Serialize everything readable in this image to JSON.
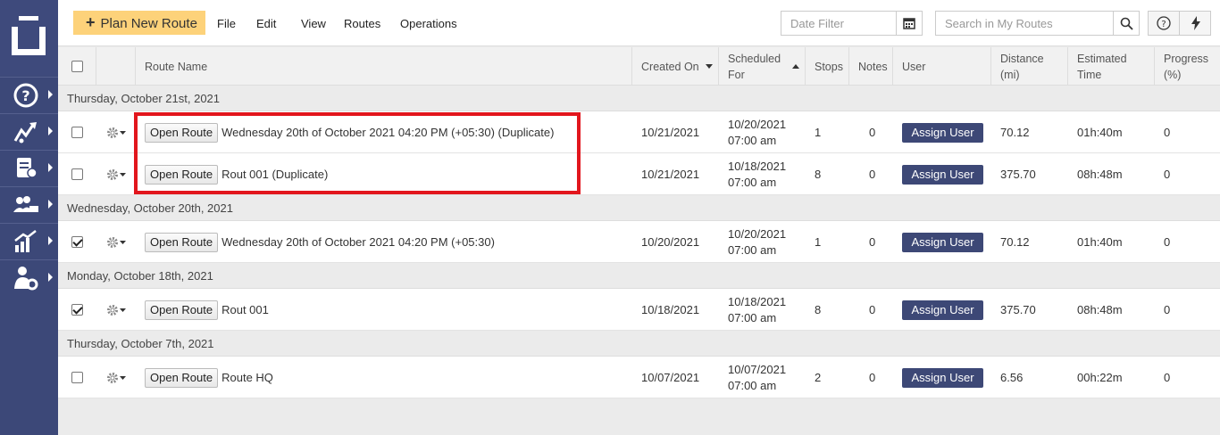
{
  "toolbar": {
    "plan_button": "Plan New Route",
    "menu": [
      "File",
      "Edit",
      "View",
      "Routes",
      "Operations"
    ],
    "date_filter_placeholder": "Date Filter",
    "search_placeholder": "Search in My Routes"
  },
  "columns": {
    "route_name": "Route Name",
    "created_on": "Created On",
    "scheduled_for": [
      "Scheduled",
      "For"
    ],
    "stops": "Stops",
    "notes": "Notes",
    "user": "User",
    "distance": [
      "Distance",
      "(mi)"
    ],
    "estimated_time": [
      "Estimated",
      "Time"
    ],
    "progress": [
      "Progress",
      "(%)"
    ]
  },
  "groups": [
    {
      "label": "Thursday, October 21st, 2021",
      "rows": [
        {
          "checked": false,
          "open_label": "Open Route",
          "name": "Wednesday 20th of October 2021 04:20 PM (+05:30) (Duplicate)",
          "created": "10/21/2021",
          "sched_date": "10/20/2021",
          "sched_time": "07:00 am",
          "stops": "1",
          "notes": "0",
          "assign": "Assign User",
          "distance": "70.12",
          "time": "01h:40m",
          "progress": "0"
        },
        {
          "checked": false,
          "open_label": "Open Route",
          "name": "Rout 001 (Duplicate)",
          "created": "10/21/2021",
          "sched_date": "10/18/2021",
          "sched_time": "07:00 am",
          "stops": "8",
          "notes": "0",
          "assign": "Assign User",
          "distance": "375.70",
          "time": "08h:48m",
          "progress": "0"
        }
      ]
    },
    {
      "label": "Wednesday, October 20th, 2021",
      "rows": [
        {
          "checked": true,
          "open_label": "Open Route",
          "name": "Wednesday 20th of October 2021 04:20 PM (+05:30)",
          "created": "10/20/2021",
          "sched_date": "10/20/2021",
          "sched_time": "07:00 am",
          "stops": "1",
          "notes": "0",
          "assign": "Assign User",
          "distance": "70.12",
          "time": "01h:40m",
          "progress": "0"
        }
      ]
    },
    {
      "label": "Monday, October 18th, 2021",
      "rows": [
        {
          "checked": true,
          "open_label": "Open Route",
          "name": "Rout 001",
          "created": "10/18/2021",
          "sched_date": "10/18/2021",
          "sched_time": "07:00 am",
          "stops": "8",
          "notes": "0",
          "assign": "Assign User",
          "distance": "375.70",
          "time": "08h:48m",
          "progress": "0"
        }
      ]
    },
    {
      "label": "Thursday, October 7th, 2021",
      "rows": [
        {
          "checked": false,
          "open_label": "Open Route",
          "name": "Route HQ",
          "created": "10/07/2021",
          "sched_date": "10/07/2021",
          "sched_time": "07:00 am",
          "stops": "2",
          "notes": "0",
          "assign": "Assign User",
          "distance": "6.56",
          "time": "00h:22m",
          "progress": "0"
        }
      ]
    }
  ],
  "colors": {
    "sidebar": "#3c4878",
    "accent": "#fdd27a",
    "assign_button": "#3d4876",
    "highlight": "#e2161d"
  },
  "icons": [
    "logo-icon",
    "help-icon",
    "routes-icon",
    "addressbook-icon",
    "team-icon",
    "analytics-icon",
    "user-settings-icon",
    "calendar-icon",
    "search-icon",
    "question-icon",
    "bolt-icon",
    "gear-icon"
  ]
}
